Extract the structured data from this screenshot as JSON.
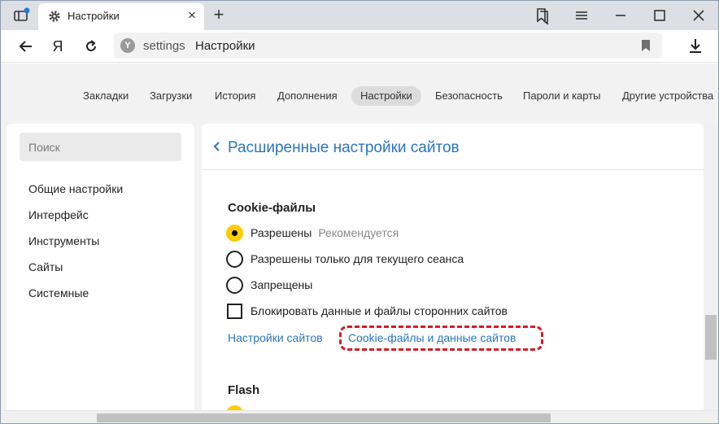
{
  "tab": {
    "title": "Настройки"
  },
  "address": {
    "host": "settings",
    "title": "Настройки"
  },
  "settings_nav": {
    "items": [
      "Закладки",
      "Загрузки",
      "История",
      "Дополнения",
      "Настройки",
      "Безопасность",
      "Пароли и карты",
      "Другие устройства"
    ],
    "active": "Настройки"
  },
  "sidebar": {
    "search_placeholder": "Поиск",
    "items": [
      "Общие настройки",
      "Интерфейс",
      "Инструменты",
      "Сайты",
      "Системные"
    ]
  },
  "main": {
    "page_title": "Расширенные настройки сайтов",
    "cookies": {
      "title": "Cookie-файлы",
      "options": [
        {
          "label": "Разрешены",
          "hint": "Рекомендуется",
          "checked": true
        },
        {
          "label": "Разрешены только для текущего сеанса",
          "checked": false
        },
        {
          "label": "Запрещены",
          "checked": false
        }
      ],
      "block_third_party": {
        "label": "Блокировать данные и файлы сторонних сайтов",
        "checked": false
      },
      "link_site_settings": "Настройки сайтов",
      "link_cookies_data": "Cookie-файлы и данные сайтов"
    },
    "flash": {
      "title": "Flash"
    }
  },
  "colors": {
    "accent_link": "#2a75c4",
    "radio_active": "#ffcc00",
    "highlight": "#d81b26"
  },
  "icons": [
    "tabs-icon",
    "gear-icon",
    "close-icon",
    "plus-icon",
    "bookmarks-panel-icon",
    "menu-icon",
    "minimize-icon",
    "maximize-icon",
    "close-window-icon",
    "back-icon",
    "yandex-icon",
    "reload-icon",
    "site-info-icon",
    "bookmark-icon",
    "download-icon",
    "chevron-left-icon"
  ]
}
